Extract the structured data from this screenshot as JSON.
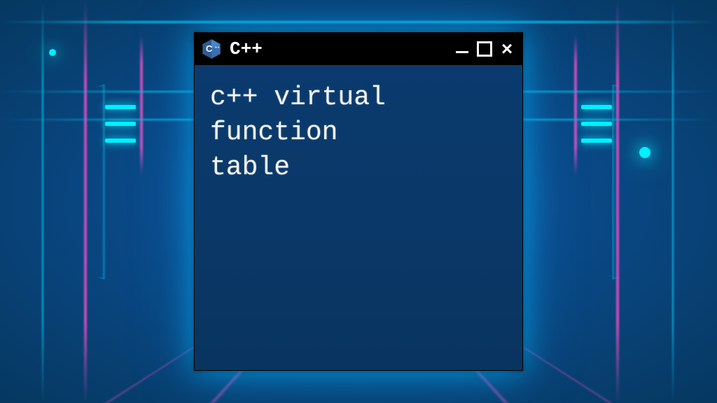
{
  "window": {
    "title": "C++",
    "app_icon_name": "cpp-hexagon-icon"
  },
  "controls": {
    "minimize_label": "Minimize",
    "maximize_label": "Maximize",
    "close_label": "Close"
  },
  "content": {
    "text": "c++ virtual\nfunction\ntable"
  },
  "colors": {
    "titlebar_bg": "#000000",
    "terminal_bg": "#0a3868",
    "text": "#f5f5f0",
    "glow_cyan": "#00d4ff",
    "glow_pink": "#ff4dcc"
  }
}
